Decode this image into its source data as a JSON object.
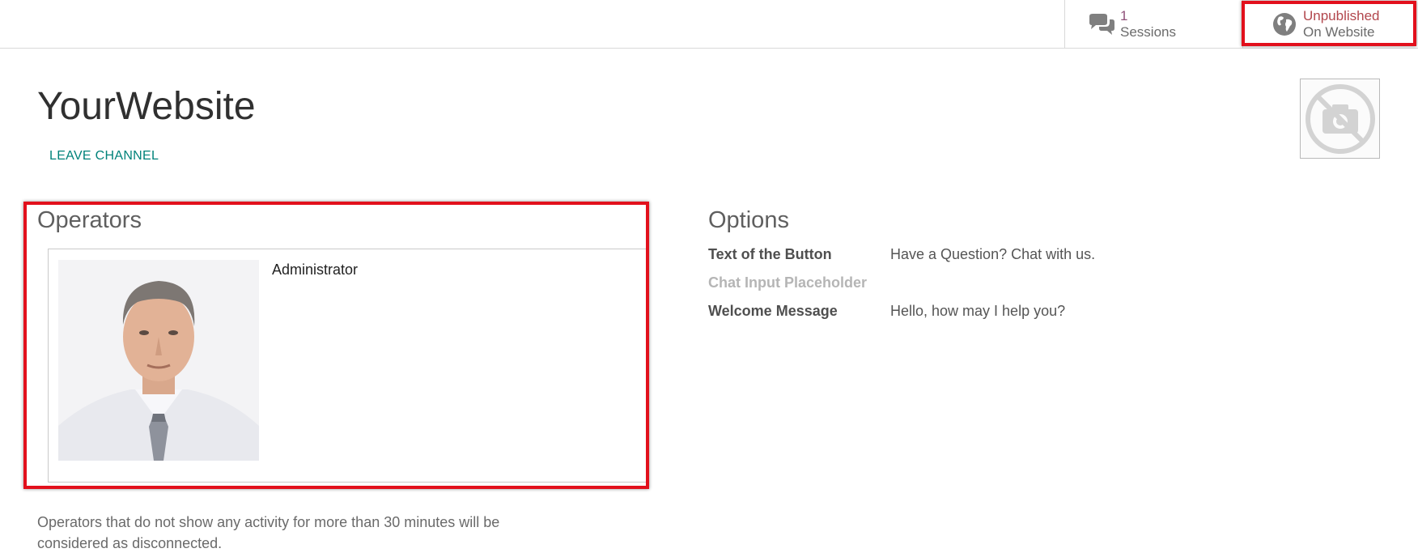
{
  "header": {
    "sessions": {
      "value": "1",
      "label": "Sessions",
      "icon": "chat-bubbles-icon"
    },
    "publish": {
      "value": "Unpublished",
      "label": "On Website",
      "icon": "globe-icon"
    }
  },
  "record": {
    "title": "YourWebsite",
    "leave_label": "LEAVE CHANNEL",
    "image_icon": "no-camera-icon"
  },
  "operators": {
    "heading": "Operators",
    "items": [
      {
        "name": "Administrator"
      }
    ],
    "help": "Operators that do not show any activity for more than 30 minutes will be considered as disconnected."
  },
  "options": {
    "heading": "Options",
    "fields": [
      {
        "label": "Text of the Button",
        "value": "Have a Question? Chat with us."
      },
      {
        "label": "Chat Input Placeholder",
        "value": ""
      },
      {
        "label": "Welcome Message",
        "value": "Hello, how may I help you?"
      }
    ]
  },
  "colors": {
    "highlight": "#e2101c",
    "link": "#00827a",
    "unpublished": "#b2474d"
  }
}
